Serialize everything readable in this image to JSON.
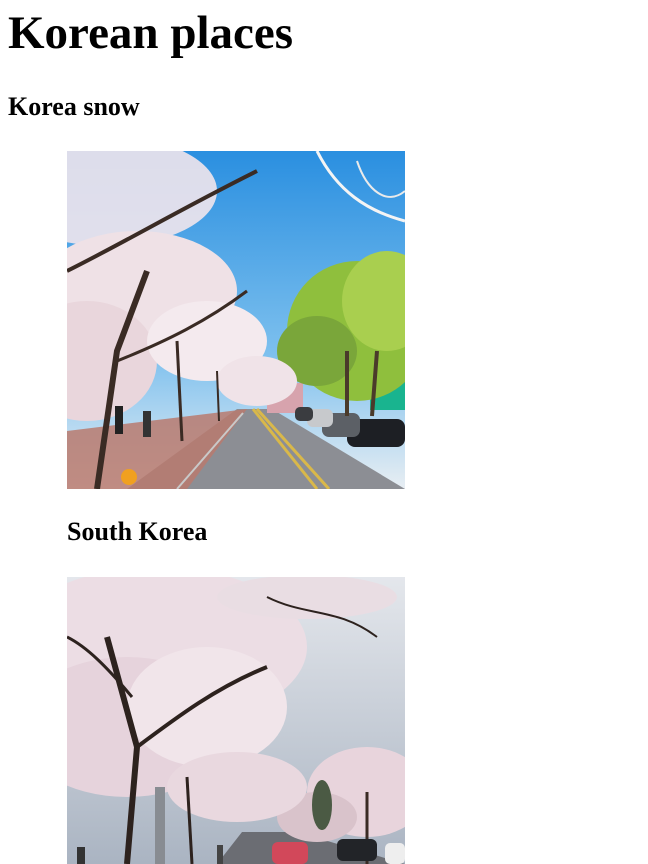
{
  "page": {
    "title": "Korean places",
    "section_heading": "Korea snow",
    "caption": "South Korea"
  },
  "images": [
    {
      "subject": "cherry blossom lined street with parked cars, blue sky"
    },
    {
      "subject": "cherry blossom trees over a street with cars, cloudy sky"
    }
  ]
}
